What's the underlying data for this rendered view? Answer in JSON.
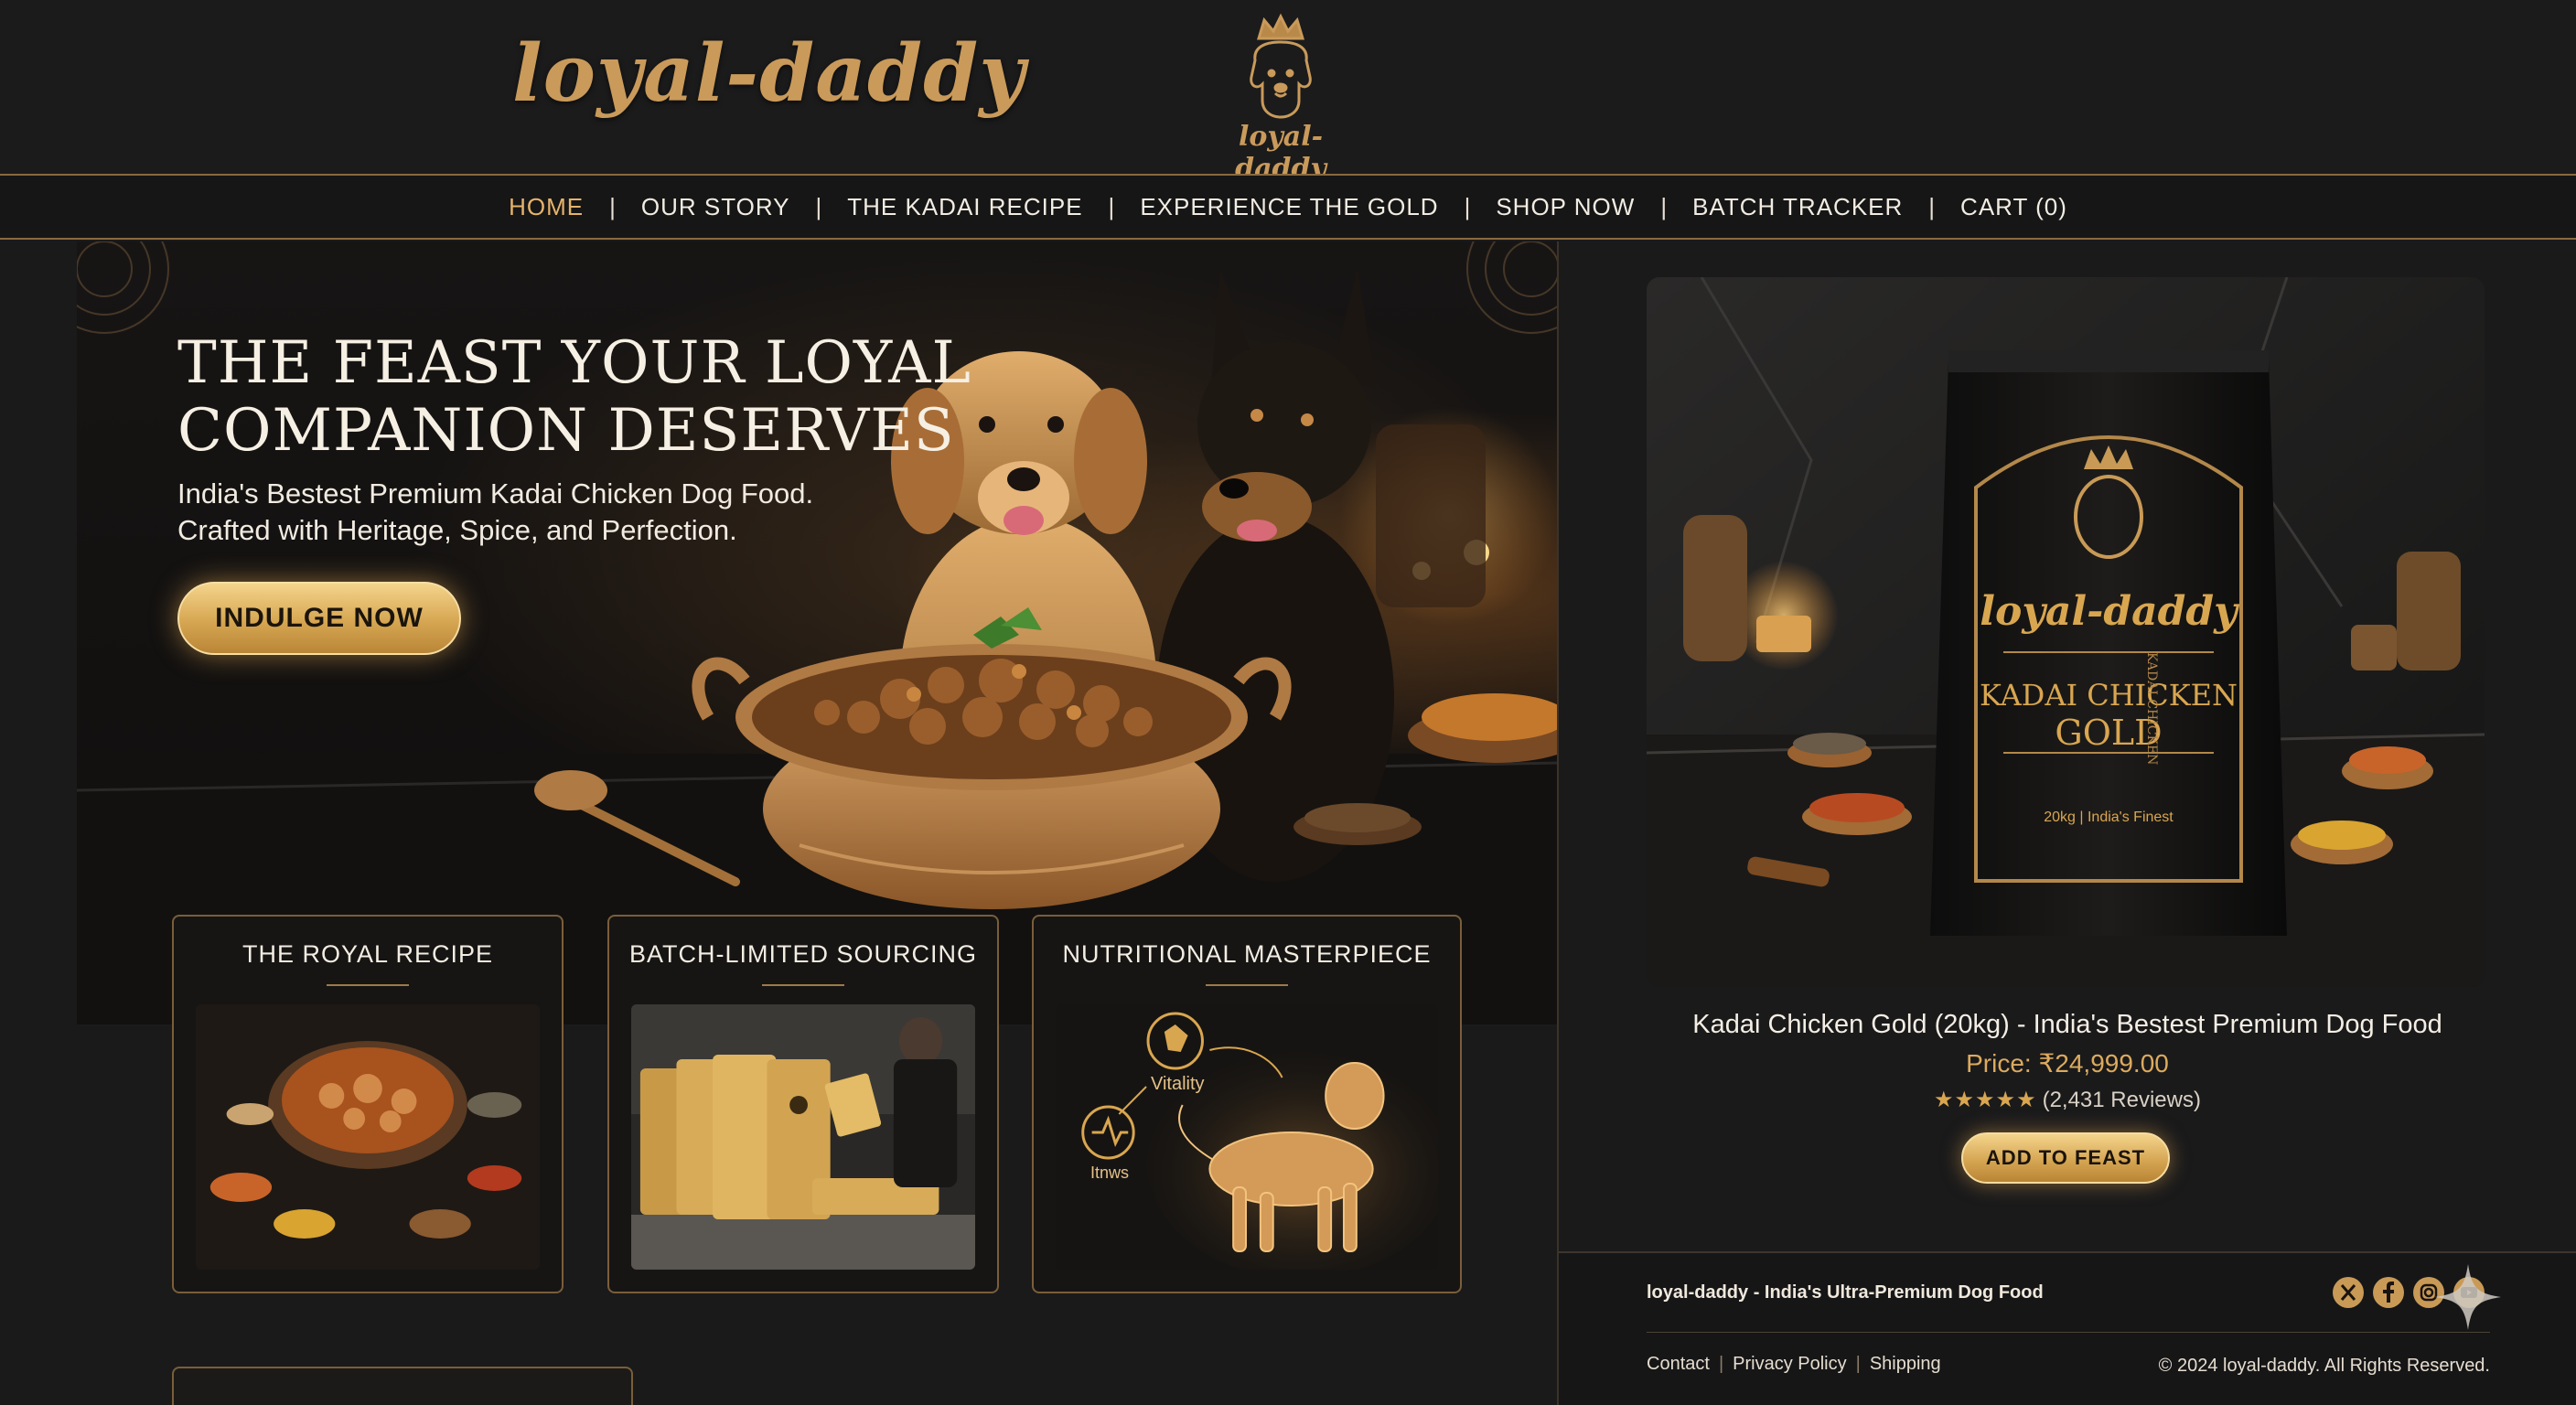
{
  "brand": {
    "wordmark": "loyal-daddy",
    "crest_text": "loyal-daddy"
  },
  "nav": {
    "items": [
      {
        "label": "HOME",
        "active": true
      },
      {
        "label": "OUR STORY"
      },
      {
        "label": "THE KADAI RECIPE"
      },
      {
        "label": "EXPERIENCE THE GOLD"
      },
      {
        "label": "SHOP NOW"
      },
      {
        "label": "BATCH TRACKER"
      },
      {
        "label": "CART (0)"
      }
    ],
    "separator": "|"
  },
  "hero": {
    "title": "THE FEAST YOUR LOYAL COMPANION DESERVES",
    "subtitle_line1": "India's Bestest Premium Kadai Chicken Dog Food.",
    "subtitle_line2": "Crafted with Heritage, Spice, and Perfection.",
    "cta": "INDULGE NOW"
  },
  "cards": [
    {
      "title": "THE ROYAL RECIPE",
      "image": "kadai-curry-spices-photo"
    },
    {
      "title": "BATCH-LIMITED SOURCING",
      "image": "gold-bags-production-photo"
    },
    {
      "title": "NUTRITIONAL MASTERPIECE",
      "image": "glowing-dog-infographic",
      "labels": [
        "Vitality",
        "Itnws"
      ]
    }
  ],
  "product": {
    "bag_brand": "loyal-daddy",
    "bag_line1": "KADAI CHICKEN",
    "bag_line2": "GOLD",
    "bag_footer": "20kg | India's Finest",
    "bag_side": "KADAI CHICKEN",
    "name": "Kadai Chicken Gold (20kg) - India's Bestest Premium Dog Food",
    "price": "Price: ₹24,999.00",
    "stars": "★★★★★",
    "rating_value": 5,
    "reviews": "(2,431 Reviews)",
    "cta": "ADD TO FEAST"
  },
  "footer": {
    "brand_line": "loyal-daddy - India's Ultra-Premium Dog Food",
    "links": [
      "Contact",
      "Privacy Policy",
      "Shipping"
    ],
    "link_separator": "|",
    "copyright": "© 2024 loyal-daddy. All Rights Reserved.",
    "social": [
      "x-icon",
      "facebook-icon",
      "instagram-icon",
      "youtube-icon"
    ]
  },
  "colors": {
    "accent_gold": "#d6a652",
    "background": "#1a1a1b",
    "nav_active": "#e6b36a",
    "border_gold": "#7a5e3a"
  }
}
